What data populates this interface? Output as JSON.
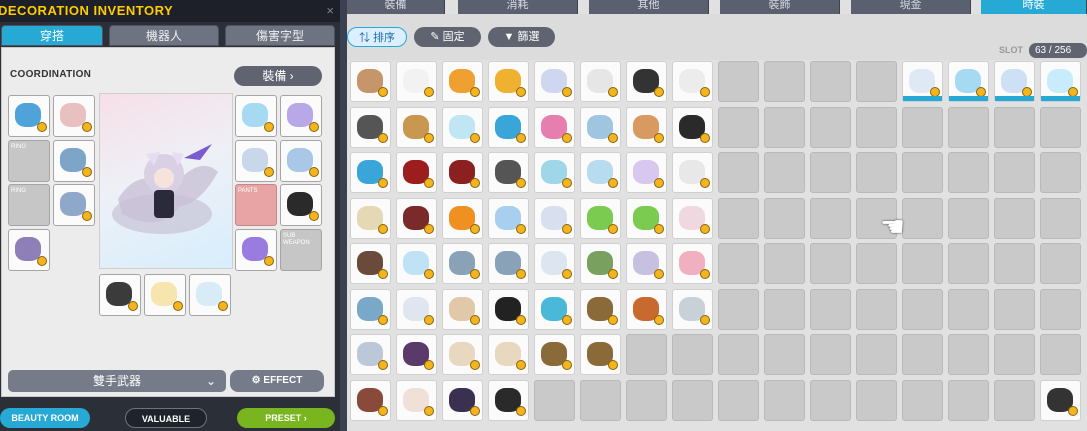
{
  "window": {
    "title": "DECORATION INVENTORY",
    "close_label": "×"
  },
  "left_tabs": [
    {
      "label": "穿搭",
      "active": true
    },
    {
      "label": "機器人",
      "active": false
    },
    {
      "label": "傷害字型",
      "active": false
    }
  ],
  "coordination": {
    "label": "COORDINATION",
    "equip_button": "裝備"
  },
  "equip_slots": [
    {
      "label": "",
      "color": "#4fa3d9",
      "filled": true,
      "pink": false
    },
    {
      "label": "",
      "color": "#e9c0c0",
      "filled": true,
      "pink": false
    },
    {
      "label": "RING",
      "color": "",
      "filled": false,
      "pink": false
    },
    {
      "label": "",
      "color": "#7ea5c8",
      "filled": true,
      "pink": false
    },
    {
      "label": "RING",
      "color": "",
      "filled": false,
      "pink": false
    },
    {
      "label": "",
      "color": "#8fa8c9",
      "filled": true,
      "pink": false
    },
    {
      "label": "",
      "color": "#8e7fb8",
      "filled": true,
      "pink": false
    },
    {
      "label": "",
      "color": "#a6d9f2",
      "filled": true,
      "pink": false
    },
    {
      "label": "",
      "color": "#b8a8e8",
      "filled": true,
      "pink": false
    },
    {
      "label": "",
      "color": "#c8d8ea",
      "filled": true,
      "pink": false
    },
    {
      "label": "",
      "color": "#a9c7e6",
      "filled": true,
      "pink": false
    },
    {
      "label": "PANTS",
      "color": "",
      "filled": false,
      "pink": true
    },
    {
      "label": "",
      "color": "#2a2a2a",
      "filled": true,
      "pink": false
    },
    {
      "label": "",
      "color": "#9a7be0",
      "filled": true,
      "pink": false
    },
    {
      "label": "SUB WEAPON",
      "color": "",
      "filled": false,
      "pink": false
    },
    {
      "label": "",
      "color": "#3b3b3b",
      "filled": true,
      "pink": false
    },
    {
      "label": "",
      "color": "#f7e5b0",
      "filled": true,
      "pink": false
    },
    {
      "label": "",
      "color": "#d8ecf7",
      "filled": true,
      "pink": false
    }
  ],
  "weapon_select": {
    "value": "雙手武器",
    "chevron": "⌄"
  },
  "effect_button": {
    "label": "EFFECT",
    "icon": "gear-icon"
  },
  "bottom_buttons": {
    "beauty": "BEAUTY ROOM",
    "valuable": "VALUABLE",
    "preset": "PRESET"
  },
  "inv_tabs": [
    {
      "label": "裝備",
      "active": false
    },
    {
      "label": "消耗",
      "active": false
    },
    {
      "label": "其他",
      "active": false
    },
    {
      "label": "裝飾",
      "active": false
    },
    {
      "label": "現金",
      "active": false
    },
    {
      "label": "時裝",
      "active": true
    }
  ],
  "toolbar": {
    "sort": "排序",
    "pin": "固定",
    "filter": "篩選",
    "slot_label": "SLOT",
    "slot_count": "63 / 256"
  },
  "inventory_colors": [
    [
      "#c7956a",
      "#f2f2f2",
      "#f0a030",
      "#f0b030",
      "#cfd6ef",
      "#e6e6e6",
      "#333333",
      "#ececec",
      "",
      "",
      "",
      "",
      "#dfe8f5",
      "#a6d9f2",
      "#cde0f5",
      "#c8ecfb"
    ],
    [
      "#555555",
      "#c89850",
      "#bfe6f2",
      "#3aa5d8",
      "#e67fb0",
      "#9fc5e0",
      "#d89a60",
      "#2a2a2a",
      "",
      "",
      "",
      "",
      "",
      "",
      "",
      ""
    ],
    [
      "#3aa5d8",
      "#9b1d1d",
      "#8a2020",
      "#555555",
      "#9fd6e8",
      "#b8dcef",
      "#d8c8f0",
      "#e8e8e8",
      "",
      "",
      "",
      "",
      "",
      "",
      "",
      ""
    ],
    [
      "#e5d8b5",
      "#7a2a2a",
      "#f09020",
      "#a8cfef",
      "#d8e0f0",
      "#7acb50",
      "#7acb50",
      "#f0d8e0",
      "",
      "",
      "",
      "",
      "",
      "",
      "",
      ""
    ],
    [
      "#6a4a3a",
      "#bfe2f5",
      "#8aa2b8",
      "#8aa2b8",
      "#dde6f0",
      "#7aa060",
      "#c8c0e0",
      "#f0b0c0",
      "",
      "",
      "",
      "",
      "",
      "",
      "",
      ""
    ],
    [
      "#7aa8c8",
      "#e0e6f0",
      "#e0c8a8",
      "#222222",
      "#4ab8d8",
      "#8b6a3a",
      "#c86a30",
      "#c8d0d8",
      "",
      "",
      "",
      "",
      "",
      "",
      "",
      ""
    ],
    [
      "#bcc8d8",
      "#5a3a6a",
      "#e8d8c0",
      "#e8d8c0",
      "#8b6a3a",
      "#8b6a3a",
      "",
      "",
      "",
      "",
      "",
      "",
      "",
      "",
      "",
      ""
    ],
    [
      "#8a4a3a",
      "#f0e0d8",
      "#3a3050",
      "#2a2a2a",
      "",
      "",
      "",
      "",
      "",
      "",
      "",
      "",
      "",
      "",
      "",
      "#333333"
    ]
  ],
  "inventory_bars": [
    [
      12,
      13,
      14,
      15
    ]
  ]
}
